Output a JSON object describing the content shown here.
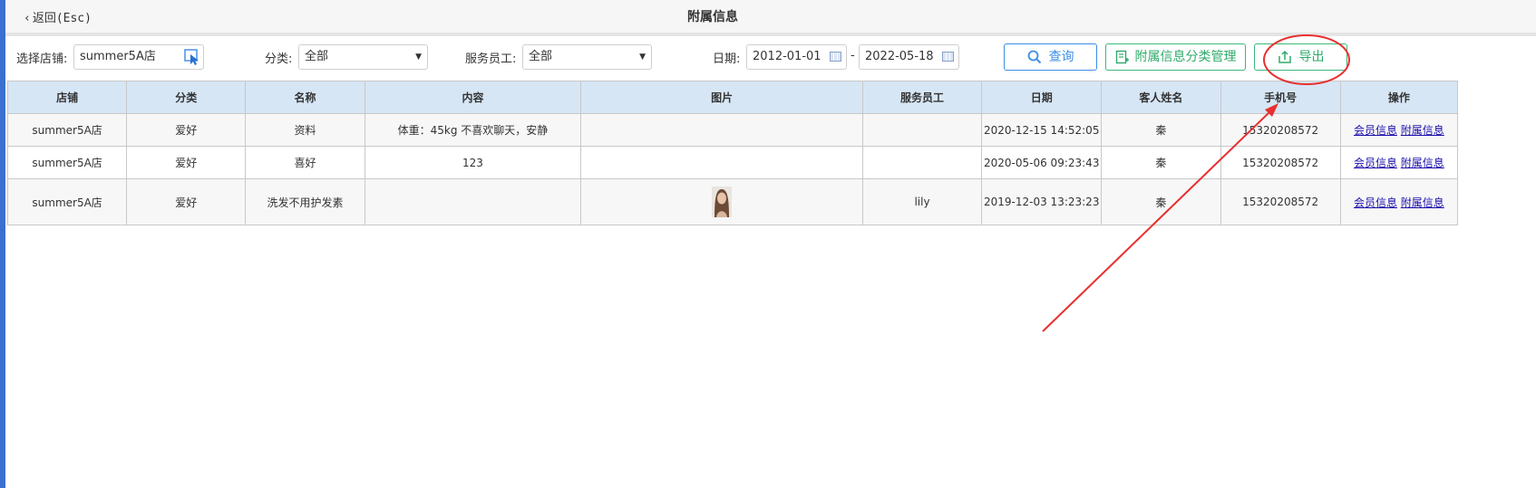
{
  "header": {
    "back_label": "返回(Esc)",
    "title": "附属信息"
  },
  "filters": {
    "store_label": "选择店铺:",
    "store_value": "summer5A店",
    "category_label": "分类:",
    "category_value": "全部",
    "staff_label": "服务员工:",
    "staff_value": "全部",
    "date_label": "日期:",
    "date_from": "2012-01-01",
    "date_sep": "-",
    "date_to": "2022-05-18"
  },
  "toolbar": {
    "search_label": "查询",
    "category_manage_label": "附属信息分类管理",
    "export_label": "导出"
  },
  "table": {
    "columns": [
      "店铺",
      "分类",
      "名称",
      "内容",
      "图片",
      "服务员工",
      "日期",
      "客人姓名",
      "手机号",
      "操作"
    ],
    "rows": [
      {
        "store": "summer5A店",
        "category": "爱好",
        "name": "资料",
        "content": "体重：45kg 不喜欢聊天，安静",
        "has_image": false,
        "staff": "",
        "date": "2020-12-15 14:52:05",
        "guest": "秦",
        "phone": "15320208572",
        "op1": "会员信息",
        "op2": "附属信息"
      },
      {
        "store": "summer5A店",
        "category": "爱好",
        "name": "喜好",
        "content": "123",
        "has_image": false,
        "staff": "",
        "date": "2020-05-06 09:23:43",
        "guest": "秦",
        "phone": "15320208572",
        "op1": "会员信息",
        "op2": "附属信息"
      },
      {
        "store": "summer5A店",
        "category": "爱好",
        "name": "洗发不用护发素",
        "content": "",
        "has_image": true,
        "staff": "lily",
        "date": "2019-12-03 13:23:23",
        "guest": "秦",
        "phone": "15320208572",
        "op1": "会员信息",
        "op2": "附属信息"
      }
    ]
  },
  "colors": {
    "accent_blue": "#3a8ee6",
    "accent_green": "#2eaa6a",
    "header_bg": "#d6e6f5",
    "annotation_red": "#e8302f"
  }
}
